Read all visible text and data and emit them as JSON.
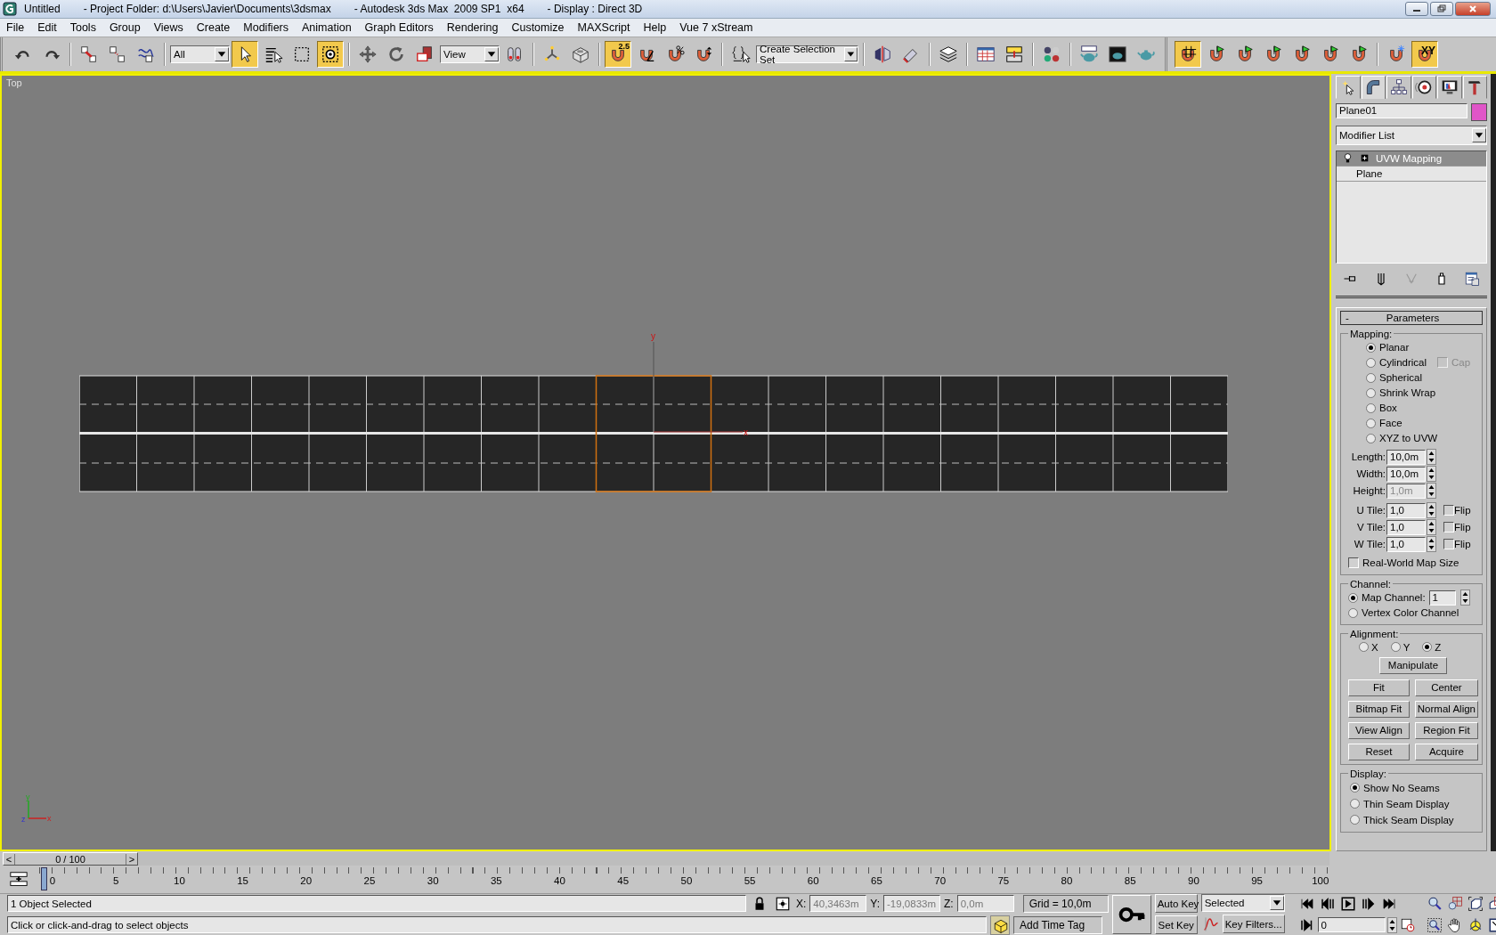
{
  "window": {
    "title_parts": [
      "Untitled",
      "- Project Folder: d:\\Users\\Javier\\Documents\\3dsmax",
      "- Autodesk 3ds Max  2009 SP1  x64",
      "- Display : Direct 3D"
    ]
  },
  "menu": [
    "File",
    "Edit",
    "Tools",
    "Group",
    "Views",
    "Create",
    "Modifiers",
    "Animation",
    "Graph Editors",
    "Rendering",
    "Customize",
    "MAXScript",
    "Help",
    "Vue 7 xStream"
  ],
  "main_toolbar": [
    {
      "kind": "undo",
      "on": false
    },
    {
      "kind": "redo",
      "on": false
    },
    {
      "kind": "separator"
    },
    {
      "kind": "link",
      "on": false
    },
    {
      "kind": "unlink",
      "on": false
    },
    {
      "kind": "bind",
      "on": false
    },
    {
      "kind": "separator"
    },
    {
      "kind": "dropdown",
      "text": "All"
    },
    {
      "kind": "cursor",
      "on": true
    },
    {
      "kind": "selname",
      "on": false
    },
    {
      "kind": "rect",
      "on": false
    },
    {
      "kind": "crossing",
      "on": true
    },
    {
      "kind": "separator"
    },
    {
      "kind": "move",
      "on": false
    },
    {
      "kind": "rotate",
      "on": false
    },
    {
      "kind": "scale",
      "on": false
    },
    {
      "kind": "dropdown",
      "text": "View"
    },
    {
      "kind": "pivot",
      "on": false
    },
    {
      "kind": "separator"
    },
    {
      "kind": "manip",
      "on": false
    },
    {
      "kind": "keyb",
      "on": false
    },
    {
      "kind": "separator"
    },
    {
      "kind": "snap",
      "text": "2.5",
      "on": true
    },
    {
      "kind": "angle",
      "on": false
    },
    {
      "kind": "percent",
      "on": false
    },
    {
      "kind": "spinner",
      "on": false
    },
    {
      "kind": "separator"
    },
    {
      "kind": "named",
      "on": false
    },
    {
      "kind": "dropdown",
      "text": "Create Selection Set"
    },
    {
      "kind": "separator"
    },
    {
      "kind": "mirror",
      "on": false
    },
    {
      "kind": "align",
      "on": false
    },
    {
      "kind": "separator"
    },
    {
      "kind": "layers",
      "on": false
    },
    {
      "kind": "separator"
    },
    {
      "kind": "table",
      "on": false
    },
    {
      "kind": "schematic",
      "on": false
    },
    {
      "kind": "separator"
    },
    {
      "kind": "spheres",
      "on": false
    },
    {
      "kind": "separator"
    },
    {
      "kind": "teapot",
      "on": false
    },
    {
      "kind": "frame",
      "on": false
    },
    {
      "kind": "teapot2",
      "on": false
    }
  ],
  "snap_toolbar": [
    {
      "kind": "grid",
      "on": true
    },
    {
      "kind": "flag",
      "on": false
    },
    {
      "kind": "flag",
      "on": false
    },
    {
      "kind": "flag",
      "on": false
    },
    {
      "kind": "flag",
      "on": false
    },
    {
      "kind": "flag",
      "on": false
    },
    {
      "kind": "flag",
      "on": false
    },
    {
      "kind": "separator"
    },
    {
      "kind": "freeze",
      "on": false
    },
    {
      "kind": "constraint",
      "text": "XY",
      "on": true
    }
  ],
  "viewport": {
    "label": "Top",
    "gizmo_labels": [
      "y",
      "x"
    ],
    "tripod_labels": [
      "y",
      "z",
      "x"
    ]
  },
  "command_panel": {
    "tabs": [
      {
        "kind": "create",
        "selected": false
      },
      {
        "kind": "modify",
        "selected": true
      },
      {
        "kind": "hierarchy",
        "selected": false
      },
      {
        "kind": "motion",
        "selected": false
      },
      {
        "kind": "display",
        "selected": false
      },
      {
        "kind": "utilities",
        "selected": false
      }
    ],
    "object_name": "Plane01",
    "modifier_list": "Modifier List",
    "stack": [
      {
        "label": "UVW Mapping",
        "selected": true,
        "expandable": true
      },
      {
        "label": "Plane",
        "selected": false,
        "expandable": false
      }
    ],
    "rollout": {
      "collapse_sign": "-",
      "title": "Parameters",
      "mapping": {
        "title": "Mapping:",
        "options": [
          {
            "label": "Planar",
            "selected": true
          },
          {
            "label": "Cylindrical",
            "selected": false,
            "checkbox": {
              "label": "Cap",
              "checked": false,
              "disabled": true
            }
          },
          {
            "label": "Spherical",
            "selected": false
          },
          {
            "label": "Shrink Wrap",
            "selected": false
          },
          {
            "label": "Box",
            "selected": false
          },
          {
            "label": "Face",
            "selected": false
          },
          {
            "label": "XYZ to UVW",
            "selected": false
          }
        ],
        "sizes": [
          {
            "label": "Length:",
            "value": "10,0m",
            "disabled": false
          },
          {
            "label": "Width:",
            "value": "10,0m",
            "disabled": false
          },
          {
            "label": "Height:",
            "value": "1,0m",
            "disabled": true
          }
        ],
        "tiles": [
          {
            "label": "U Tile:",
            "value": "1,0",
            "flip_label": "Flip",
            "flip": false
          },
          {
            "label": "V Tile:",
            "value": "1,0",
            "flip_label": "Flip",
            "flip": false
          },
          {
            "label": "W Tile:",
            "value": "1,0",
            "flip_label": "Flip",
            "flip": false
          }
        ],
        "real_world": {
          "label": "Real-World Map Size",
          "checked": false
        }
      },
      "channel": {
        "title": "Channel:",
        "options": [
          {
            "label": "Map Channel:",
            "selected": true,
            "value": "1"
          },
          {
            "label": "Vertex Color Channel",
            "selected": false
          }
        ]
      },
      "alignment": {
        "title": "Alignment:",
        "axes": [
          {
            "label": "X",
            "selected": false
          },
          {
            "label": "Y",
            "selected": false
          },
          {
            "label": "Z",
            "selected": true
          }
        ],
        "wide_button": "Manipulate",
        "buttons": [
          "Fit",
          "Center",
          "Bitmap Fit",
          "Normal Align",
          "View Align",
          "Region Fit",
          "Reset",
          "Acquire"
        ]
      },
      "display": {
        "title": "Display:",
        "options": [
          {
            "label": "Show No Seams",
            "selected": true
          },
          {
            "label": "Thin Seam Display",
            "selected": false
          },
          {
            "label": "Thick Seam Display",
            "selected": false
          }
        ]
      }
    }
  },
  "timeline": {
    "prev": "<",
    "label": "0 / 100",
    "next": ">",
    "level": 0,
    "ruler": [
      "0",
      "5",
      "10",
      "15",
      "20",
      "25",
      "30",
      "35",
      "40",
      "45",
      "50",
      "55",
      "60",
      "65",
      "70",
      "75",
      "80",
      "85",
      "90",
      "95",
      "100"
    ]
  },
  "status": {
    "selection": "1 Object Selected",
    "prompt": "Click or click-and-drag to select objects",
    "x_label": "X:",
    "x": "40,3463m",
    "y_label": "Y:",
    "y": "-19,0833m",
    "z_label": "Z:",
    "z": "0,0m",
    "grid": "Grid = 10,0m",
    "add_time_tag": "Add Time Tag",
    "auto_key": "Auto Key",
    "key_mode": "Selected",
    "set_key": "Set Key",
    "key_filters": "Key Filters...",
    "frame": "0"
  }
}
